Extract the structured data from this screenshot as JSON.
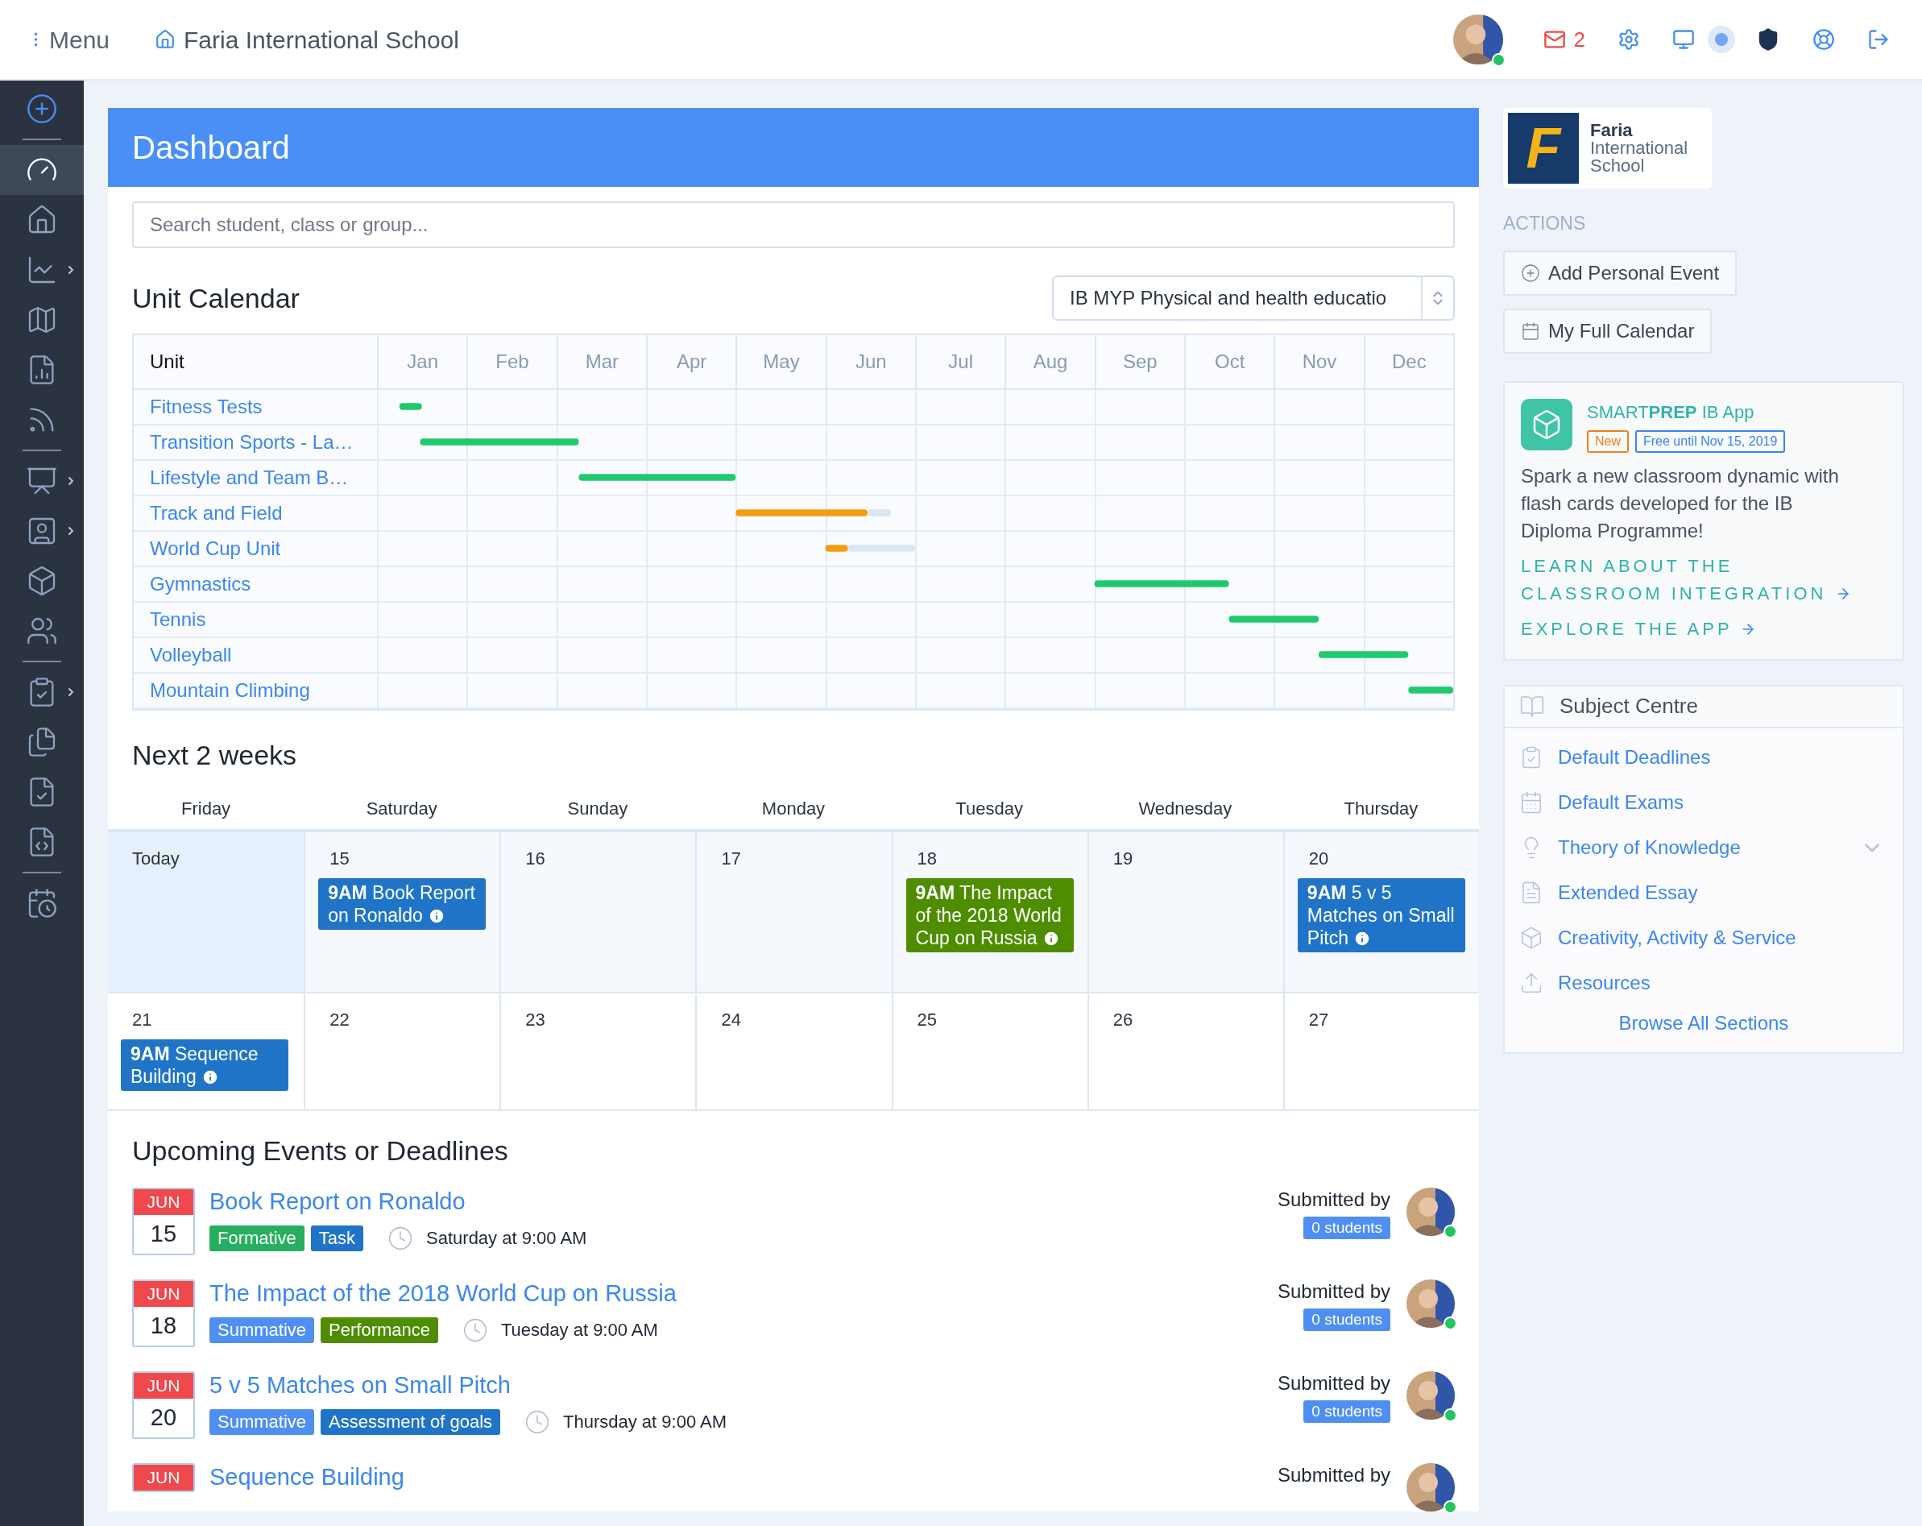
{
  "topbar": {
    "menu_label": "Menu",
    "school_name": "Faria International School",
    "mail_count": "2"
  },
  "sidebar": {
    "groups": [
      [
        {
          "selected": false,
          "submenu": false
        }
      ],
      [
        {
          "selected": true,
          "submenu": false
        },
        {
          "selected": false,
          "submenu": false
        },
        {
          "selected": false,
          "submenu": true
        },
        {
          "selected": false,
          "submenu": false
        },
        {
          "selected": false,
          "submenu": false
        },
        {
          "selected": false,
          "submenu": false
        }
      ],
      [
        {
          "selected": false,
          "submenu": true
        },
        {
          "selected": false,
          "submenu": true
        },
        {
          "selected": false,
          "submenu": false
        },
        {
          "selected": false,
          "submenu": false
        }
      ],
      [
        {
          "selected": false,
          "submenu": true
        },
        {
          "selected": false,
          "submenu": false
        },
        {
          "selected": false,
          "submenu": false
        },
        {
          "selected": false,
          "submenu": false
        }
      ],
      [
        {
          "selected": false,
          "submenu": false
        }
      ]
    ]
  },
  "dashboard": {
    "title": "Dashboard",
    "search": {
      "placeholder": "Search student, class or group..."
    }
  },
  "unit_calendar": {
    "title": "Unit Calendar",
    "select_value": "IB MYP Physical and health educatio",
    "unit_header": "Unit",
    "months": [
      "Jan",
      "Feb",
      "Mar",
      "Apr",
      "May",
      "Jun",
      "Jul",
      "Aug",
      "Sep",
      "Oct",
      "Nov",
      "Dec"
    ],
    "units": [
      {
        "name": "Fitness Tests"
      },
      {
        "name": "Transition Sports - La…"
      },
      {
        "name": "Lifestyle and Team B…"
      },
      {
        "name": "Track and Field"
      },
      {
        "name": "World Cup Unit"
      },
      {
        "name": "Gymnastics"
      },
      {
        "name": "Tennis"
      },
      {
        "name": "Volleyball"
      },
      {
        "name": "Mountain Climbing"
      }
    ]
  },
  "next_weeks": {
    "title": "Next 2 weeks",
    "weekdays": [
      "Friday",
      "Saturday",
      "Sunday",
      "Monday",
      "Tuesday",
      "Wednesday",
      "Thursday"
    ],
    "weeks": [
      {
        "current": true,
        "days": [
          {
            "label": "Today",
            "today": true
          },
          {
            "label": "15",
            "today": false,
            "events": [
              {
                "time": "9AM",
                "title": "Book Report on Ronaldo",
                "color": "#2074c8"
              }
            ]
          },
          {
            "label": "16",
            "today": false
          },
          {
            "label": "17",
            "today": false
          },
          {
            "label": "18",
            "today": false,
            "events": [
              {
                "time": "9AM",
                "title": "The Impact of the 2018 World Cup on Russia",
                "color": "#4e8d00"
              }
            ]
          },
          {
            "label": "19",
            "today": false
          },
          {
            "label": "20",
            "today": false,
            "events": [
              {
                "time": "9AM",
                "title": "5 v 5 Matches on Small Pitch",
                "color": "#2074c8"
              }
            ]
          }
        ]
      },
      {
        "current": false,
        "days": [
          {
            "label": "21",
            "today": false,
            "events": [
              {
                "time": "9AM",
                "title": "Sequence Building",
                "color": "#2074c8"
              }
            ]
          },
          {
            "label": "22",
            "today": false
          },
          {
            "label": "23",
            "today": false
          },
          {
            "label": "24",
            "today": false
          },
          {
            "label": "25",
            "today": false
          },
          {
            "label": "26",
            "today": false
          },
          {
            "label": "27",
            "today": false
          }
        ]
      }
    ]
  },
  "upcoming": {
    "title": "Upcoming Events or Deadlines",
    "items": [
      {
        "month": "JUN",
        "day": "15",
        "title": "Book Report on Ronaldo",
        "tags": [
          {
            "label": "Formative",
            "color": "#27ae60"
          },
          {
            "label": "Task",
            "color": "#2074c8"
          }
        ],
        "time": "Saturday at 9:00 AM",
        "submitted_label": "Submitted by",
        "submitted_count": "0 students"
      },
      {
        "month": "JUN",
        "day": "18",
        "title": "The Impact of the 2018 World Cup on Russia",
        "tags": [
          {
            "label": "Summative",
            "color": "#4f8ff2"
          },
          {
            "label": "Performance",
            "color": "#4e8d00"
          }
        ],
        "time": "Tuesday at 9:00 AM",
        "submitted_label": "Submitted by",
        "submitted_count": "0 students"
      },
      {
        "month": "JUN",
        "day": "20",
        "title": "5 v 5 Matches on Small Pitch",
        "tags": [
          {
            "label": "Summative",
            "color": "#4f8ff2"
          },
          {
            "label": "Assessment of goals",
            "color": "#2074c8"
          }
        ],
        "time": "Thursday at 9:00 AM",
        "submitted_label": "Submitted by",
        "submitted_count": "0 students"
      },
      {
        "month": "JUN",
        "title": "Sequence Building",
        "submitted_label": "Submitted by"
      }
    ]
  },
  "logo": {
    "letter": "F",
    "lines": [
      "Faria",
      "International",
      "School"
    ]
  },
  "actions": {
    "title": "ACTIONS",
    "buttons": [
      {
        "label": "Add Personal Event"
      },
      {
        "label": "My Full Calendar"
      }
    ]
  },
  "promo": {
    "title": "SMART**PREP** IB App",
    "badges": [
      {
        "label": "New",
        "color": "#f0801e"
      },
      {
        "label": "Free until Nov 15, 2019",
        "color": "#3b82f6"
      }
    ],
    "text": "Spark a new classroom dynamic with flash cards developed for the IB Diploma Programme!",
    "links": [
      "LEARN ABOUT THE CLASSROOM INTEGRATION",
      "EXPLORE THE APP"
    ]
  },
  "subject_centre": {
    "title": "Subject Centre",
    "items": [
      {
        "label": "Default Deadlines",
        "expandable": false
      },
      {
        "label": "Default Exams",
        "expandable": false
      },
      {
        "label": "Theory of Knowledge",
        "expandable": true
      },
      {
        "label": "Extended Essay",
        "expandable": false
      },
      {
        "label": "Creativity, Activity & Service",
        "expandable": false
      },
      {
        "label": "Resources",
        "expandable": false
      }
    ],
    "footer_link": "Browse All Sections"
  }
}
